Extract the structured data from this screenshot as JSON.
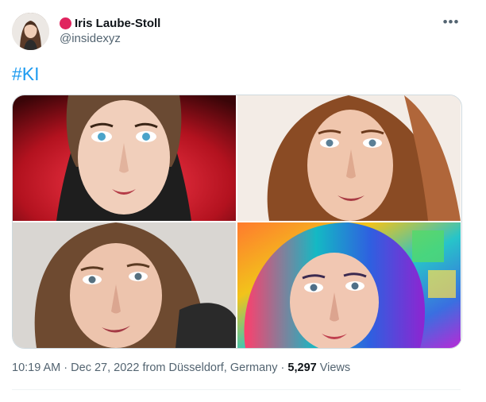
{
  "author": {
    "display_name": "Iris Laube-Stoll",
    "handle": "@insidexyz",
    "avatar_icon": "profile-photo",
    "badge_color": "#e0245e"
  },
  "menu": {
    "more_label": "•••"
  },
  "tweet": {
    "text": "#KI",
    "link_color": "#1d9bf0"
  },
  "media": {
    "images": [
      {
        "description_icon": "portrait-red-background"
      },
      {
        "description_icon": "portrait-auburn-hair"
      },
      {
        "description_icon": "portrait-grey-background"
      },
      {
        "description_icon": "portrait-rainbow-hair"
      }
    ]
  },
  "footer": {
    "time": "10:19 AM",
    "separator": "·",
    "date": "Dec 27, 2022",
    "location": "from Düsseldorf, Germany",
    "views_count": "5,297",
    "views_label": "Views"
  }
}
